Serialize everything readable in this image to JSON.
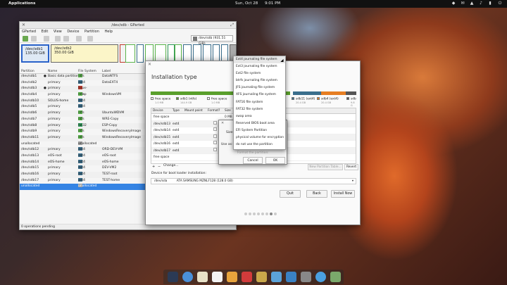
{
  "top_panel": {
    "applications": "Applications",
    "date": "Sun, Oct 28",
    "time": "9:01 PM",
    "indicators": [
      "notification-icon",
      "mail-icon",
      "network-icon",
      "volume-icon",
      "battery-icon",
      "power-icon"
    ]
  },
  "gparted": {
    "title": "/dev/sdb - GParted",
    "menu": [
      "GParted",
      "Edit",
      "View",
      "Device",
      "Partition",
      "Help"
    ],
    "device_selector": "/dev/sdb  (931.51 GiB)",
    "map": [
      {
        "name": "/dev/sdb1",
        "size": "135.00 GiB"
      },
      {
        "name": "/dev/sdb2",
        "size": "350.00 GiB"
      }
    ],
    "columns": [
      "Partition",
      "Name",
      "File System",
      "Label"
    ],
    "rows": [
      {
        "partition": "/dev/sdb1",
        "name": "Basic data partition",
        "fs": "ntfs",
        "fs_color": "#5ab44b",
        "label": "DataNTFS",
        "flag": true
      },
      {
        "partition": "/dev/sdb2",
        "name": "primary",
        "fs": "ext4",
        "fs_color": "#3a6e8c",
        "label": "DataEXT4",
        "flag": false
      },
      {
        "partition": "/dev/sdb3",
        "name": "primary",
        "fs": "linux-swap",
        "fs_color": "#c0392b",
        "label": "",
        "flag": true
      },
      {
        "partition": "/dev/sdb4",
        "name": "primary",
        "fs": "ntfs",
        "fs_color": "#5ab44b",
        "label": "WindowsVM",
        "flag": false
      },
      {
        "partition": "/dev/sdb10",
        "name": "SOLUS-home",
        "fs": "ext4",
        "fs_color": "#3a6e8c",
        "label": "",
        "flag": false
      },
      {
        "partition": "/dev/sdb5",
        "name": "primary",
        "fs": "ext4",
        "fs_color": "#3a6e8c",
        "label": "",
        "flag": false
      },
      {
        "partition": "/dev/sdb6",
        "name": "primary",
        "fs": "ntfs",
        "fs_color": "#5ab44b",
        "label": "UbuntuWDVM",
        "flag": false
      },
      {
        "partition": "/dev/sdb7",
        "name": "primary",
        "fs": "ntfs",
        "fs_color": "#5ab44b",
        "label": "WRE-Copy",
        "flag": false
      },
      {
        "partition": "/dev/sdb8",
        "name": "primary",
        "fs": "fat32",
        "fs_color": "#2f9a5a",
        "label": "ESP-Copy",
        "flag": false
      },
      {
        "partition": "/dev/sdb9",
        "name": "primary",
        "fs": "ntfs",
        "fs_color": "#5ab44b",
        "label": "WindowsRecoveryImage",
        "flag": false
      },
      {
        "partition": "/dev/sdb11",
        "name": "primary",
        "fs": "ntfs",
        "fs_color": "#5ab44b",
        "label": "WindowsRecoveryImage",
        "flag": false
      },
      {
        "partition": "unallocated",
        "name": "",
        "fs": "unallocated",
        "fs_color": "#a0a0a0",
        "label": "",
        "flag": false
      },
      {
        "partition": "/dev/sdb12",
        "name": "primary",
        "fs": "ext4",
        "fs_color": "#3a6e8c",
        "label": "ORD-DEV-VM",
        "flag": false
      },
      {
        "partition": "/dev/sdb13",
        "name": "eOS-root",
        "fs": "ext4",
        "fs_color": "#3a6e8c",
        "label": "eOS-root",
        "flag": false
      },
      {
        "partition": "/dev/sdb14",
        "name": "eOS-home",
        "fs": "ext4",
        "fs_color": "#3a6e8c",
        "label": "eOS-home",
        "flag": false
      },
      {
        "partition": "/dev/sdb15",
        "name": "primary",
        "fs": "ext4",
        "fs_color": "#3a6e8c",
        "label": "DEV-VM2",
        "flag": false
      },
      {
        "partition": "/dev/sdb16",
        "name": "primary",
        "fs": "ext4",
        "fs_color": "#3a6e8c",
        "label": "TEST-root",
        "flag": false
      },
      {
        "partition": "/dev/sdb17",
        "name": "primary",
        "fs": "ext4",
        "fs_color": "#3a6e8c",
        "label": "TEST-home",
        "flag": false
      },
      {
        "partition": "unallocated",
        "name": "",
        "fs": "unallocated",
        "fs_color": "#a0a0a0",
        "label": "",
        "flag": false
      }
    ],
    "status": "0 operations pending"
  },
  "installer": {
    "title": "Installation type",
    "legend": [
      {
        "name": "free space",
        "size": "1.0 MB",
        "color": "#ffffff"
      },
      {
        "name": "sdb1 (ntfs)",
        "size": "144.9 GB",
        "color": "#5aa02c"
      },
      {
        "name": "free space",
        "size": "1.0 MB",
        "color": "#ffffff"
      },
      {
        "name": "sdb11 (ext4)",
        "size": "20.4 GB",
        "color": "#3a6e8c"
      },
      {
        "name": "sdb4 (ext4)",
        "size": "20.4 GB",
        "color": "#e67e22"
      },
      {
        "name": "sdb",
        "size": "9.8 G",
        "color": "#555555"
      }
    ],
    "columns": [
      "Device",
      "Type",
      "Mount point",
      "Format?",
      "Size"
    ],
    "rows": [
      {
        "device": "free space",
        "type": "",
        "size": "0 MB"
      },
      {
        "device": "/dev/sdb13",
        "type": "ext4",
        "size": ""
      },
      {
        "device": "/dev/sdb14",
        "type": "ext4",
        "size": ""
      },
      {
        "device": "/dev/sdb15",
        "type": "ext4",
        "size": ""
      },
      {
        "device": "/dev/sdb16",
        "type": "ext4",
        "size": ""
      },
      {
        "device": "/dev/sdb17",
        "type": "ext4",
        "size": ""
      },
      {
        "device": "free space",
        "type": "",
        "size": ""
      }
    ],
    "add": "+",
    "remove": "−",
    "change": "Change...",
    "new_partition_table": "New Partition Table...",
    "revert": "Revert",
    "boot_label": "Device for boot loader installation:",
    "boot_device": "/dev/sda",
    "boot_model": "ATA SAMSUNG MZNLF128 (128.0 GB)",
    "quit": "Quit",
    "back": "Back",
    "install_now": "Install Now"
  },
  "create_dialog": {
    "size_label": "Size:",
    "use_as_label": "Use as:",
    "format_label": "Format the partition:",
    "cancel": "Cancel",
    "ok": "OK"
  },
  "fs_dropdown": {
    "items": [
      "Ext4 journaling file system",
      "Ext3 journaling file system",
      "Ext2 file system",
      "btrfs journaling file system",
      "JFS journaling file system",
      "XFS journaling file system",
      "FAT16 file system",
      "FAT32 file system",
      "swap area",
      "Reserved BIOS boot area",
      "EFI System Partition",
      "physical volume for encryption",
      "do not use the partition"
    ],
    "highlighted": 0
  },
  "dock": [
    "multitasking-view-icon",
    "files-icon",
    "web-browser-icon",
    "mail-icon",
    "calendar-icon",
    "music-icon",
    "videos-icon",
    "photos-icon",
    "app-center-icon",
    "settings-icon",
    "software-icon",
    "installer-icon"
  ]
}
